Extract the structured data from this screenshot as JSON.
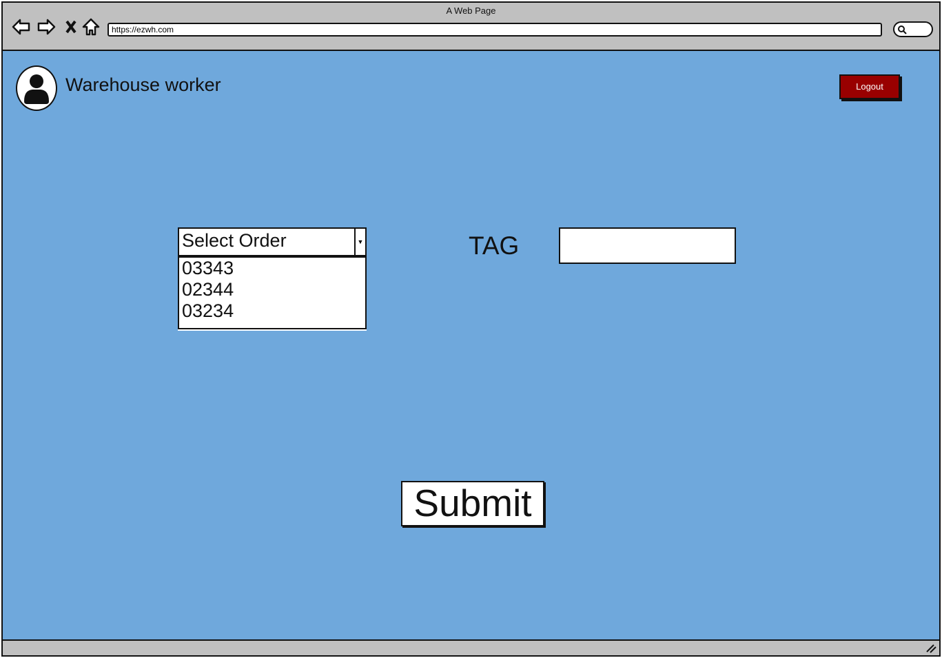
{
  "browser": {
    "title": "A Web Page",
    "url": "https://ezwh.com"
  },
  "header": {
    "user_name": "Warehouse worker",
    "logout_label": "Logout"
  },
  "form": {
    "order_select": {
      "label": "Select Order",
      "options": [
        "03343",
        "02344",
        "03234"
      ]
    },
    "tag_label": "TAG",
    "tag_value": "",
    "submit_label": "Submit"
  },
  "colors": {
    "background": "#6fa8dc",
    "logout": "#990000",
    "chrome": "#c0c0c0"
  }
}
